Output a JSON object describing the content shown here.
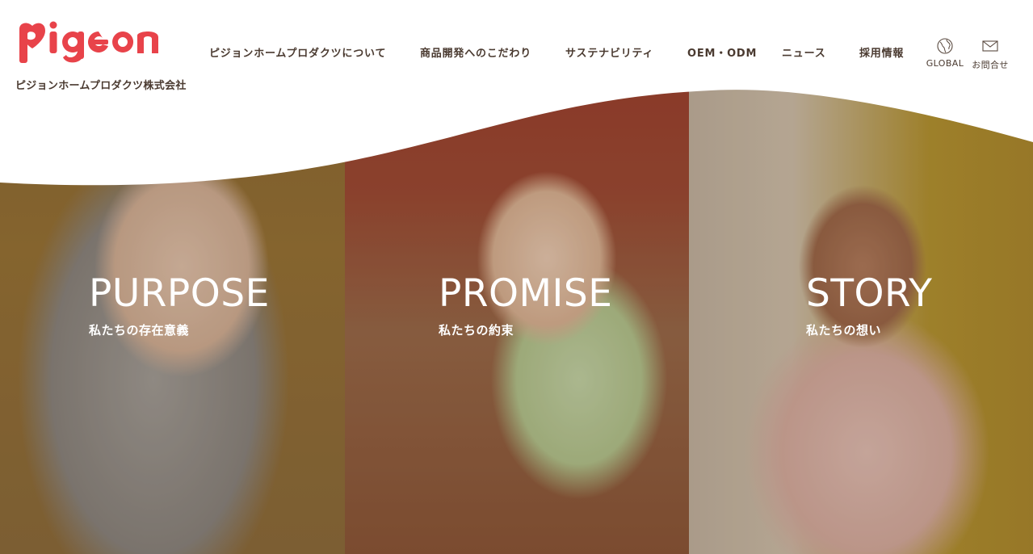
{
  "brand": {
    "logo_text": "pigeon",
    "company_name": "ピジョンホームプロダクツ株式会社",
    "brand_color": "#e8434a"
  },
  "nav": {
    "items": [
      {
        "label": "ピジョンホームプロダクツについて"
      },
      {
        "label": "商品開発へのこだわり"
      },
      {
        "label": "サステナビリティ"
      },
      {
        "label": "OEM・ODM"
      },
      {
        "label": "ニュース"
      },
      {
        "label": "採用情報"
      }
    ]
  },
  "utility": {
    "global": {
      "label": "GLOBAL",
      "icon": "globe-icon"
    },
    "contact": {
      "label": "お問合せ",
      "icon": "mail-icon"
    }
  },
  "panels": [
    {
      "title": "PURPOSE",
      "subtitle": "私たちの存在意義"
    },
    {
      "title": "PROMISE",
      "subtitle": "私たちの約束"
    },
    {
      "title": "STORY",
      "subtitle": "私たちの想い"
    }
  ]
}
